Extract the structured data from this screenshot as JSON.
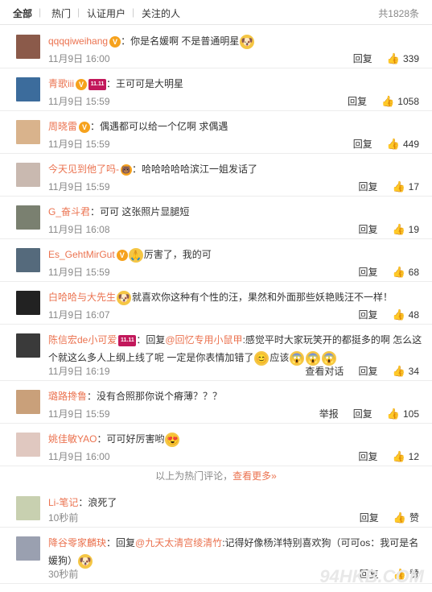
{
  "tabs": [
    {
      "label": "全部",
      "active": true
    },
    {
      "label": "热门"
    },
    {
      "label": "认证用户"
    },
    {
      "label": "关注的人"
    }
  ],
  "total": "共1828条",
  "hot_comments": [
    {
      "user": "qqqqiweihang",
      "badge": "V",
      "text": "：你是名媛啊 不是普通明星",
      "trail_emoji": "🐶",
      "time": "11月9日 16:00",
      "reply": "回复",
      "likes": "339",
      "avatar": "#8b5a4a"
    },
    {
      "user": "青歌iii",
      "badge": "V",
      "badge2": "11.11",
      "text": "：王可可是大明星",
      "time": "11月9日 15:59",
      "reply": "回复",
      "likes": "1058",
      "avatar": "#3c6c9c"
    },
    {
      "user": "周晓雷",
      "badge": "V",
      "text": "：偶遇都可以给一个亿啊 求偶遇",
      "time": "11月9日 15:59",
      "reply": "回复",
      "likes": "449",
      "avatar": "#d9b38c"
    },
    {
      "user": "今天见到他了吗-",
      "badge": "🐻",
      "text": "：哈哈哈哈哈滨江一姐发话了",
      "time": "11月9日 15:59",
      "reply": "回复",
      "likes": "17",
      "avatar": "#c9b9b0"
    },
    {
      "user": "G_奋斗君",
      "text": "：可可 这张照片显腿短",
      "time": "11月9日 16:08",
      "reply": "回复",
      "likes": "19",
      "avatar": "#7a8070"
    },
    {
      "user": "Es_GehtMirGut",
      "badge": "V",
      "lead_emoji": "🙏",
      "text": "厉害了，我的可",
      "time": "11月9日 15:59",
      "reply": "回复",
      "likes": "68",
      "avatar": "#556a7c"
    },
    {
      "user": "白哈哈与大先生",
      "lead_emoji": "🐶",
      "text": "就喜欢你这种有个性的汪，果然和外面那些妖艳贱汪不一样！",
      "time": "11月9日 16:07",
      "reply": "回复",
      "likes": "48",
      "avatar": "#222222"
    },
    {
      "user": "陈信宏de小可爱",
      "badge2": "11.11",
      "text_prefix": "：回复",
      "mention": "@回忆专用小鼠甲",
      "text": ":感觉平时大家玩笑开的都挺多的啊 怎么这个就这么多人上纲上线了呢 一定是你表情加错了",
      "tail": "应该",
      "time": "11月9日 16:19",
      "view": "查看对话",
      "reply": "回复",
      "likes": "34",
      "avatar": "#3a3a3a"
    },
    {
      "user": "璐路搀鲁",
      "text": "：没有合照那你说个瘠薄？？？",
      "time": "11月9日 15:59",
      "report": "举报",
      "reply": "回复",
      "likes": "105",
      "avatar": "#c9a07a"
    },
    {
      "user": "姚佳敏YAO",
      "text": "：可可好厉害哟",
      "trail_emoji": "😍",
      "time": "11月9日 16:00",
      "reply": "回复",
      "likes": "12",
      "avatar": "#e0c8c0"
    }
  ],
  "hot_hint_prefix": "以上为热门评论，",
  "hot_hint_link": "查看更多»",
  "recent_comments": [
    {
      "user": "Li-笔记",
      "text": "：浪死了",
      "time": "10秒前",
      "reply": "回复",
      "likes": "赞",
      "avatar": "#c8d0b0"
    },
    {
      "user": "降谷零家麟玦",
      "text_prefix": "：回复",
      "mention": "@九天太清宫绫清竹",
      "text": ":记得好像杨洋特别喜欢狗（可可os：我可是名媛狗）",
      "trail_emoji": "🐶",
      "time": "30秒前",
      "reply": "回复",
      "likes": "赞",
      "avatar": "#9aa0b0"
    }
  ],
  "watermark": "94HKB.COM"
}
